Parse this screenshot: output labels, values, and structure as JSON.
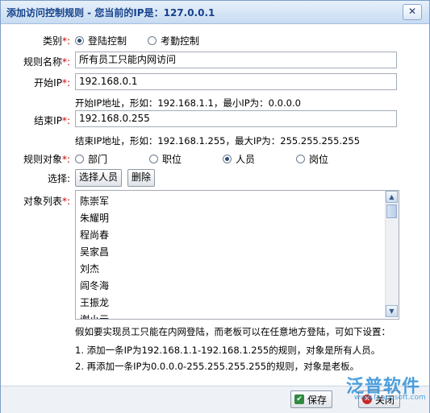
{
  "window": {
    "title": "添加访问控制规则 - 您当前的IP是：127.0.0.1",
    "close_glyph": "✕"
  },
  "form": {
    "category": {
      "label": "类别",
      "required_mark": "*:",
      "options": [
        {
          "label": "登陆控制",
          "selected": true
        },
        {
          "label": "考勤控制",
          "selected": false
        }
      ]
    },
    "rule_name": {
      "label": "规则名称",
      "required_mark": "*:",
      "value": "所有员工只能内网访问"
    },
    "start_ip": {
      "label": "开始IP",
      "required_mark": "*:",
      "value": "192.168.0.1",
      "hint": "开始IP地址，形如：192.168.1.1，最小IP为：0.0.0.0"
    },
    "end_ip": {
      "label": "结束IP",
      "required_mark": "*:",
      "value": "192.168.0.255",
      "hint": "结束IP地址，形如：192.168.1.255，最大IP为：255.255.255.255"
    },
    "rule_target": {
      "label": "规则对象",
      "required_mark": "*:",
      "options": [
        {
          "label": "部门",
          "selected": false
        },
        {
          "label": "职位",
          "selected": false
        },
        {
          "label": "人员",
          "selected": true
        },
        {
          "label": "岗位",
          "selected": false
        }
      ]
    },
    "select": {
      "label": "选择:",
      "select_button": "选择人员",
      "delete_button": "删除"
    },
    "object_list": {
      "label": "对象列表",
      "required_mark": "*:",
      "items": [
        "陈崇军",
        "朱耀明",
        "程尚春",
        "吴家昌",
        "刘杰",
        "闾冬海",
        "王振龙",
        "谢小元"
      ]
    },
    "notes": [
      "假如要实现员工只能在内网登陆，而老板可以在任意地方登陆，可如下设置：",
      "1. 添加一条IP为192.168.1.1-192.168.1.255的规则，对象是所有人员。",
      "2. 再添加一条IP为0.0.0.0-255.255.255.255的规则，对象是老板。"
    ]
  },
  "footer": {
    "save_label": "保存",
    "close_label": "关闭"
  },
  "watermark": {
    "brand": "泛普软件",
    "url": "www.fanpusoft.com"
  },
  "colors": {
    "title_text": "#15428b",
    "required": "#d00000",
    "watermark": "#2f8fd8"
  }
}
